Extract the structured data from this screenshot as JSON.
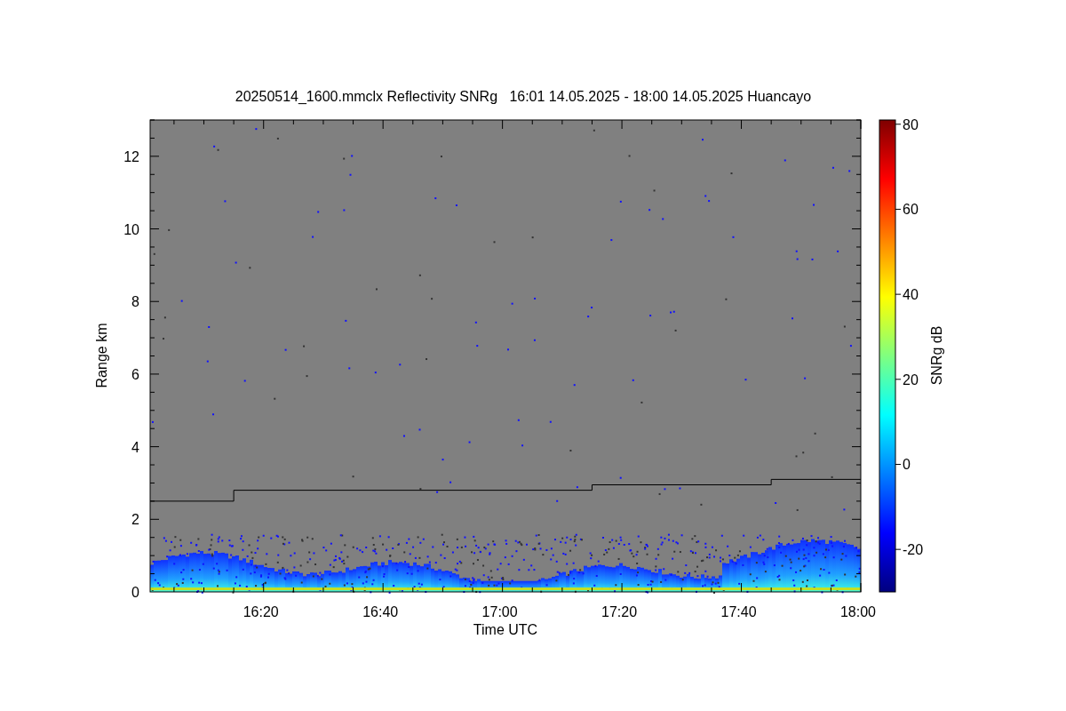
{
  "title": "20250514_1600.mmclx Reflectivity SNRg   16:01 14.05.2025 - 18:00 14.05.2025 Huancayo",
  "plot": {
    "xlabel": "Time UTC",
    "ylabel": "Range km",
    "xticks": [
      "16:20",
      "16:40",
      "17:00",
      "17:20",
      "17:40",
      "18:00"
    ],
    "yticks": [
      "12",
      "10",
      "8",
      "6",
      "4",
      "2",
      "0"
    ]
  },
  "colorbar": {
    "label": "SNRg dB",
    "ticks": [
      "80",
      "60",
      "40",
      "20",
      "0",
      "-20"
    ]
  }
}
